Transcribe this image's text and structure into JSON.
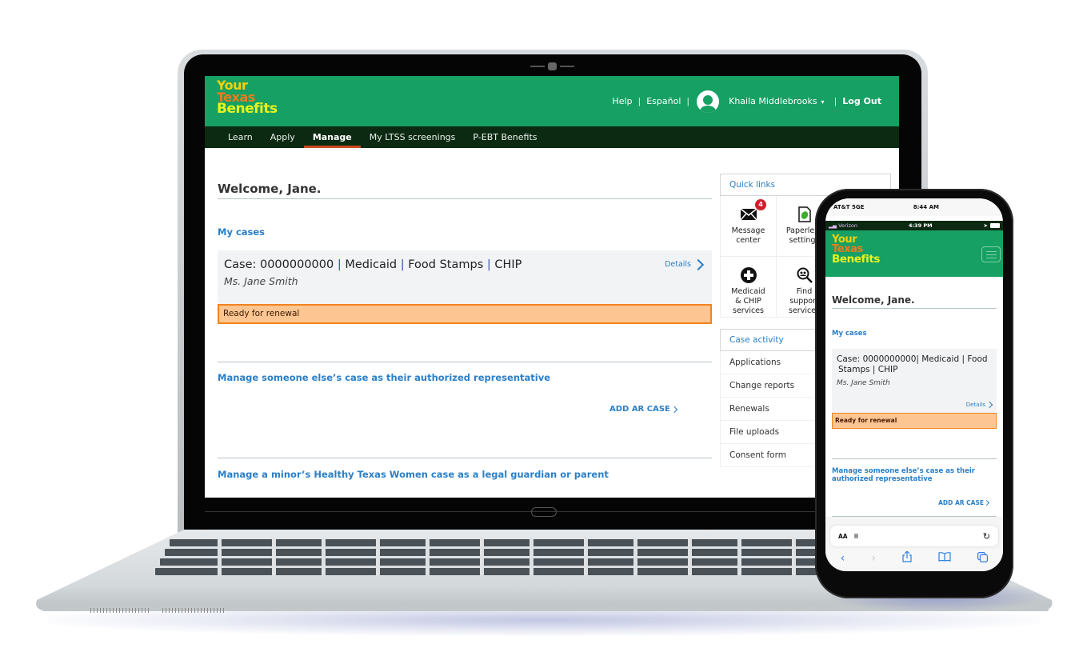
{
  "site": {
    "logo": {
      "line1": "Your",
      "line2": "Texas",
      "line3": "Benefits"
    },
    "colors": {
      "header_green": "#16a064",
      "nav_dark": "#0c2a12",
      "link_blue": "#2a7fc8",
      "renewal_fill": "#fdc592",
      "renewal_border": "#f08420",
      "active_underline": "#c94a1e",
      "badge_red": "#d0202b"
    }
  },
  "desktop": {
    "util_nav": {
      "help": "Help",
      "espanol": "Español",
      "user_name": "Khaila Middlebrooks",
      "logout": "Log Out",
      "separator": "|",
      "caret": "▾"
    },
    "main_nav": [
      {
        "label": "Learn",
        "active": false
      },
      {
        "label": "Apply",
        "active": false
      },
      {
        "label": "Manage",
        "active": true
      },
      {
        "label": "My LTSS screenings",
        "active": false
      },
      {
        "label": "P-EBT Benefits",
        "active": false
      }
    ],
    "welcome": "Welcome, Jane.",
    "my_cases_title": "My cases",
    "case": {
      "prefix": "Case: 0000000000",
      "programs": [
        "Medicaid",
        "Food Stamps",
        "CHIP"
      ],
      "name": "Ms. Jane Smith",
      "details_label": "Details",
      "status": "Ready for renewal"
    },
    "ar_title": "Manage someone else’s case as their authorized representative",
    "add_ar_label": "ADD AR CASE",
    "minor_title": "Manage a minor’s Healthy Texas Women case as a legal guardian or parent",
    "quick_links": {
      "title": "Quick links",
      "items": [
        {
          "label_line1": "Message",
          "label_line2": "center",
          "label_line3": "",
          "icon": "envelope-icon",
          "badge": "4"
        },
        {
          "label_line1": "Paperless",
          "label_line2": "settings",
          "label_line3": "",
          "icon": "paperless-leaf-icon",
          "badge": ""
        },
        {
          "label_line1": "",
          "label_line2": "",
          "label_line3": "",
          "icon": "",
          "badge": ""
        },
        {
          "label_line1": "Medicaid",
          "label_line2": "& CHIP",
          "label_line3": "services",
          "icon": "plus-circle-icon",
          "badge": ""
        },
        {
          "label_line1": "Find",
          "label_line2": "support",
          "label_line3": "services",
          "icon": "search-people-icon",
          "badge": ""
        },
        {
          "label_line1": "",
          "label_line2": "",
          "label_line3": "",
          "icon": "",
          "badge": ""
        }
      ]
    },
    "case_activity": {
      "title": "Case activity",
      "items": [
        "Applications",
        "Change reports",
        "Renewals",
        "File uploads",
        "Consent form"
      ]
    }
  },
  "phone": {
    "outer_status": {
      "carrier": "AT&T 5GE",
      "time": "8:44 AM"
    },
    "inner_status": {
      "carrier": "Verizon",
      "time": "4:39 PM"
    },
    "welcome": "Welcome, Jane.",
    "my_cases_title": "My cases",
    "case": {
      "title_line1": "Case: 0000000000| Medicaid | Food",
      "title_line2": "Stamps | CHIP",
      "name": "Ms. Jane Smith",
      "details_label": "Details",
      "status": "Ready for renewal"
    },
    "ar_title": "Manage someone else’s case as their authorized representative",
    "add_ar_label": "ADD AR CASE",
    "url_bar": {
      "text_size_label": "AA"
    },
    "browser_icons": [
      "back-icon",
      "forward-icon",
      "share-icon",
      "bookmarks-icon",
      "tabs-icon"
    ]
  }
}
